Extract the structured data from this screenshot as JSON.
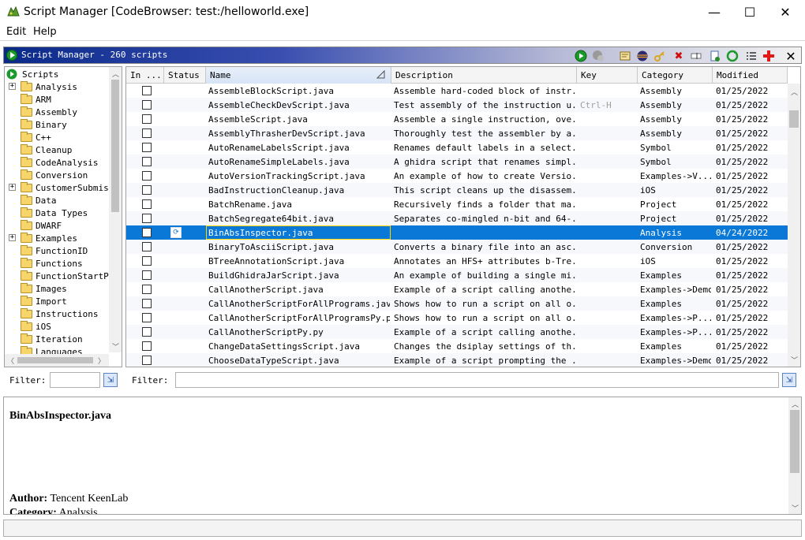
{
  "window": {
    "title": "Script Manager [CodeBrowser: test:/helloworld.exe]",
    "min_glyph": "—",
    "max_glyph": "☐",
    "close_glyph": "✕"
  },
  "menu": [
    "Edit",
    "Help"
  ],
  "panel": {
    "title": "Script Manager - 260 scripts",
    "toolbar_icons": [
      "run-script-icon",
      "run-last-script-icon",
      "edit-script-icon",
      "edit-eclipse-icon",
      "key-binding-icon",
      "delete-script-icon",
      "rename-icon",
      "new-script-icon",
      "refresh-icon",
      "script-directories-icon",
      "help-icon",
      "close-panel-icon"
    ]
  },
  "tree": {
    "root": "Scripts",
    "items": [
      {
        "label": "Analysis",
        "expandable": true
      },
      {
        "label": "ARM",
        "expandable": false
      },
      {
        "label": "Assembly",
        "expandable": false
      },
      {
        "label": "Binary",
        "expandable": false
      },
      {
        "label": "C++",
        "expandable": false
      },
      {
        "label": "Cleanup",
        "expandable": false
      },
      {
        "label": "CodeAnalysis",
        "expandable": false
      },
      {
        "label": "Conversion",
        "expandable": false
      },
      {
        "label": "CustomerSubmiss",
        "expandable": true
      },
      {
        "label": "Data",
        "expandable": false
      },
      {
        "label": "Data Types",
        "expandable": false
      },
      {
        "label": "DWARF",
        "expandable": false
      },
      {
        "label": "Examples",
        "expandable": true
      },
      {
        "label": "FunctionID",
        "expandable": false
      },
      {
        "label": "Functions",
        "expandable": false
      },
      {
        "label": "FunctionStartPa",
        "expandable": false
      },
      {
        "label": "Images",
        "expandable": false
      },
      {
        "label": "Import",
        "expandable": false
      },
      {
        "label": "Instructions",
        "expandable": false
      },
      {
        "label": "iOS",
        "expandable": false
      },
      {
        "label": "Iteration",
        "expandable": false
      },
      {
        "label": "Languages",
        "expandable": false
      }
    ],
    "filter_label": "Filter:",
    "filter_value": ""
  },
  "table": {
    "columns": [
      "In ...",
      "Status",
      "Name",
      "Description",
      "Key",
      "Category",
      "Modified"
    ],
    "rows": [
      {
        "name": "AssembleBlockScript.java",
        "desc": "Assemble hard-coded block of instr...",
        "key": "",
        "category": "Assembly",
        "modified": "01/25/2022"
      },
      {
        "name": "AssembleCheckDevScript.java",
        "desc": "Test assembly of the instruction u...",
        "key": "Ctrl-H",
        "category": "Assembly",
        "modified": "01/25/2022"
      },
      {
        "name": "AssembleScript.java",
        "desc": "Assemble a single instruction, ove...",
        "key": "",
        "category": "Assembly",
        "modified": "01/25/2022"
      },
      {
        "name": "AssemblyThrasherDevScript.java",
        "desc": "Thoroughly test the assembler by a...",
        "key": "",
        "category": "Assembly",
        "modified": "01/25/2022"
      },
      {
        "name": "AutoRenameLabelsScript.java",
        "desc": "Renames default labels in a select...",
        "key": "",
        "category": "Symbol",
        "modified": "01/25/2022"
      },
      {
        "name": "AutoRenameSimpleLabels.java",
        "desc": "A ghidra script that renames simpl...",
        "key": "",
        "category": "Symbol",
        "modified": "01/25/2022"
      },
      {
        "name": "AutoVersionTrackingScript.java",
        "desc": "An example of how to create Versio...",
        "key": "",
        "category": "Examples->V...",
        "modified": "01/25/2022"
      },
      {
        "name": "BadInstructionCleanup.java",
        "desc": "This script cleans up the disassem...",
        "key": "",
        "category": "iOS",
        "modified": "01/25/2022"
      },
      {
        "name": "BatchRename.java",
        "desc": "Recursively finds a folder that ma...",
        "key": "",
        "category": "Project",
        "modified": "01/25/2022"
      },
      {
        "name": "BatchSegregate64bit.java",
        "desc": "Separates co-mingled n-bit and 64-...",
        "key": "",
        "category": "Project",
        "modified": "01/25/2022"
      },
      {
        "name": "BinAbsInspector.java",
        "desc": "",
        "key": "",
        "category": "Analysis",
        "modified": "04/24/2022",
        "selected": true
      },
      {
        "name": "BinaryToAsciiScript.java",
        "desc": "Converts a binary file into an asc...",
        "key": "",
        "category": "Conversion",
        "modified": "01/25/2022"
      },
      {
        "name": "BTreeAnnotationScript.java",
        "desc": "Annotates an HFS+ attributes b-Tre...",
        "key": "",
        "category": "iOS",
        "modified": "01/25/2022"
      },
      {
        "name": "BuildGhidraJarScript.java",
        "desc": "An example of building a single mi...",
        "key": "",
        "category": "Examples",
        "modified": "01/25/2022"
      },
      {
        "name": "CallAnotherScript.java",
        "desc": "Example of a script calling anothe...",
        "key": "",
        "category": "Examples->Demo",
        "modified": "01/25/2022"
      },
      {
        "name": "CallAnotherScriptForAllPrograms.java",
        "desc": "Shows how to run a script on all o...",
        "key": "",
        "category": "Examples",
        "modified": "01/25/2022"
      },
      {
        "name": "CallAnotherScriptForAllProgramsPy.py",
        "desc": "Shows how to run a script on all o...",
        "key": "",
        "category": "Examples->P...",
        "modified": "01/25/2022"
      },
      {
        "name": "CallAnotherScriptPy.py",
        "desc": "Example of a script calling anothe...",
        "key": "",
        "category": "Examples->P...",
        "modified": "01/25/2022"
      },
      {
        "name": "ChangeDataSettingsScript.java",
        "desc": "Changes the dsiplay settings of th...",
        "key": "",
        "category": "Examples",
        "modified": "01/25/2022"
      },
      {
        "name": "ChooseDataTypeScript.java",
        "desc": "Example of a script prompting the ...",
        "key": "",
        "category": "Examples->Demo",
        "modified": "01/25/2022"
      }
    ],
    "filter_label": "Filter:",
    "filter_value": ""
  },
  "description": {
    "title": "BinAbsInspector.java",
    "author_label": "Author:",
    "author_value": "Tencent KeenLab",
    "category_label": "Category:",
    "category_value": "Analysis"
  },
  "colors": {
    "selection": "#0a78d7",
    "header_gradient_start": "#0a2a8a",
    "run_green": "#1a9a2a",
    "folder_yellow": "#f6d66a"
  }
}
